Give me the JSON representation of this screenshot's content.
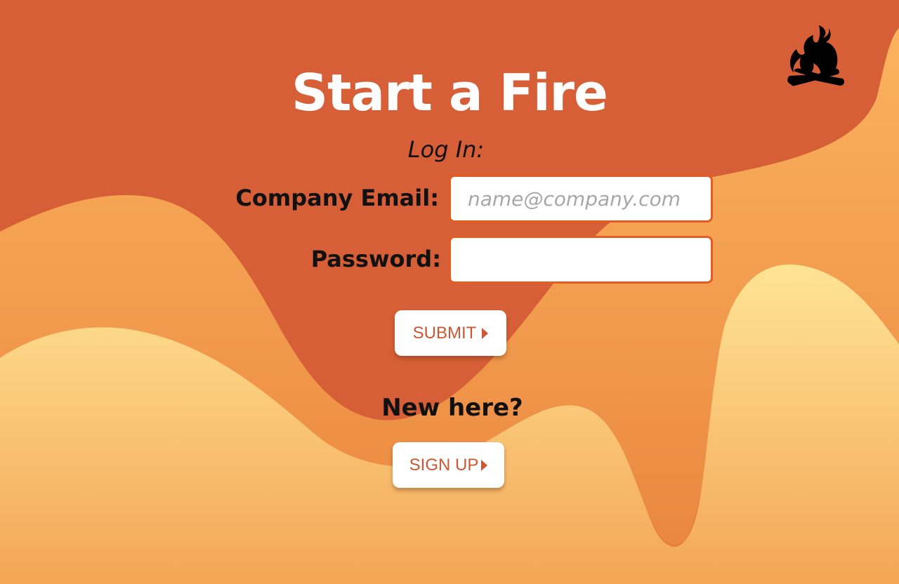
{
  "app": {
    "title": "Start a Fire"
  },
  "login": {
    "heading": "Log In:",
    "email_label": "Company Email:",
    "email_placeholder": "name@company.com",
    "email_value": "",
    "password_label": "Password:",
    "password_value": "",
    "submit_label": "SUBMIT"
  },
  "signup": {
    "prompt": "New here?",
    "button_label": "SIGN UP"
  },
  "icons": {
    "logo": "campfire-icon",
    "submit_arrow": "caret-right-icon",
    "signup_arrow": "caret-right-icon"
  },
  "colors": {
    "background_dark": "#d65f37",
    "wave_mid": "#f5a656",
    "wave_light": "#ffe391",
    "input_border": "#e45c22",
    "button_text": "#cf5631",
    "title_text": "#ffffff"
  }
}
